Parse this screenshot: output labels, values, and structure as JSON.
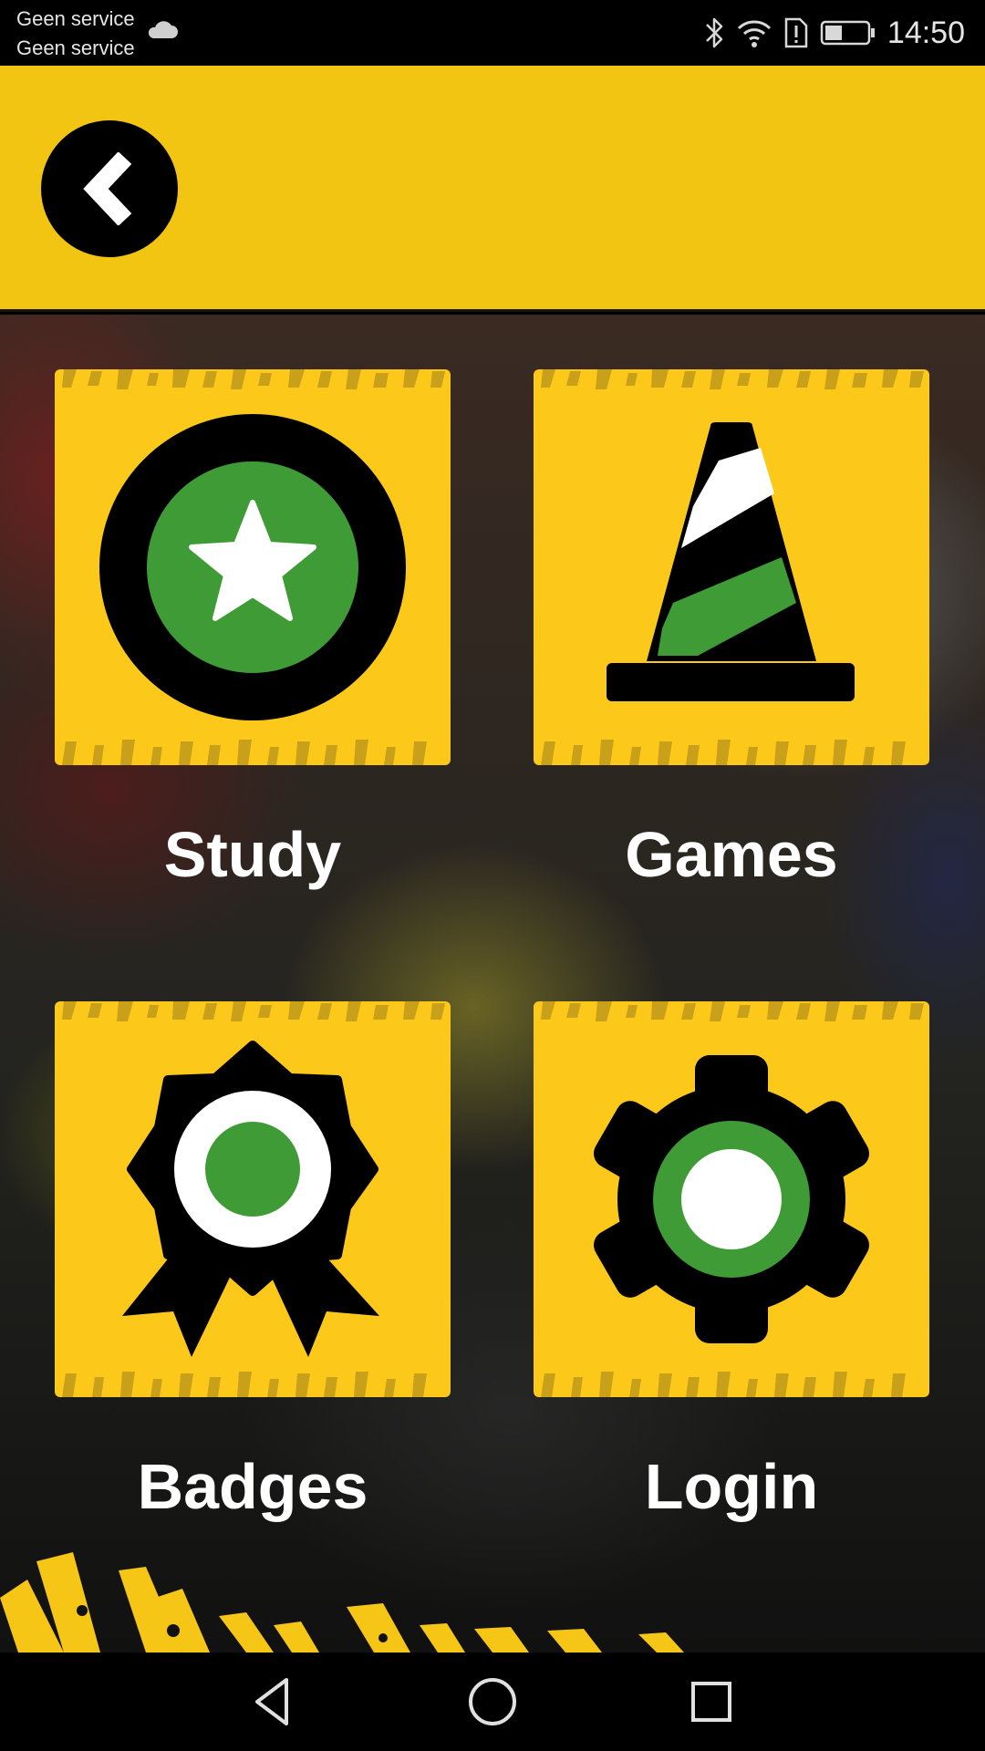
{
  "status_bar": {
    "carrier_line_1": "Geen service",
    "carrier_line_2": "Geen service",
    "time": "14:50",
    "icons": [
      "cloud-icon",
      "bluetooth-icon",
      "wifi-icon",
      "sim-alert-icon",
      "battery-icon"
    ]
  },
  "app_bar": {
    "back_icon": "chevron-left-icon",
    "color": "#f2c512"
  },
  "menu": {
    "tiles": [
      {
        "label": "Study",
        "icon": "star-badge-icon"
      },
      {
        "label": "Games",
        "icon": "traffic-cone-icon"
      },
      {
        "label": "Badges",
        "icon": "award-ribbon-icon"
      },
      {
        "label": "Login",
        "icon": "gear-icon"
      }
    ]
  },
  "colors": {
    "tile": "#fcc81a",
    "accent_green": "#3f9b35",
    "label": "#ffffff"
  },
  "nav_bar": {
    "icons": [
      "nav-back-icon",
      "nav-home-icon",
      "nav-recent-icon"
    ]
  }
}
